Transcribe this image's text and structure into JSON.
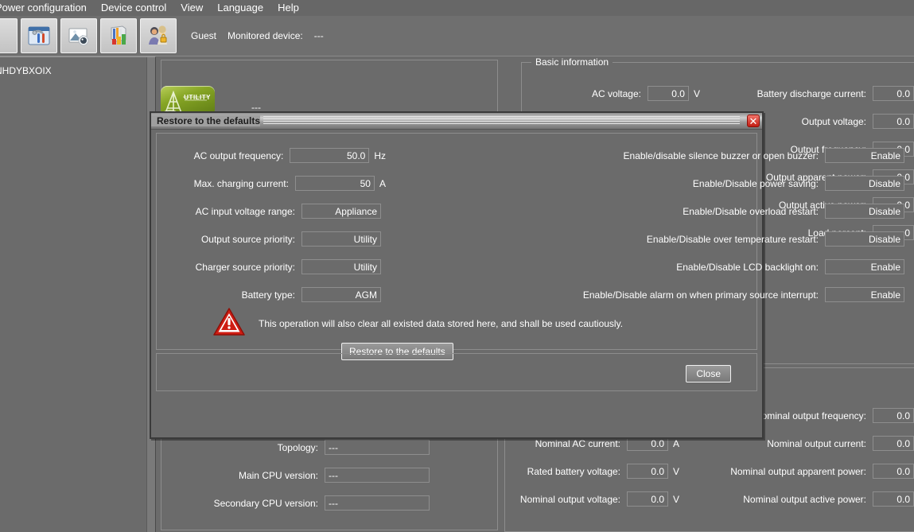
{
  "menu": {
    "items": [
      {
        "label": "Power configuration"
      },
      {
        "label": "Device control"
      },
      {
        "label": "View"
      },
      {
        "label": "Language"
      },
      {
        "label": "Help"
      }
    ]
  },
  "toolbar": {
    "buttons": [
      {
        "icon": "settings-tools-icon",
        "name": "toolbar-settings"
      },
      {
        "icon": "monitor-image-icon",
        "name": "toolbar-monitor"
      },
      {
        "icon": "chart-books-icon",
        "name": "toolbar-reports"
      },
      {
        "icon": "users-security-icon",
        "name": "toolbar-users"
      }
    ],
    "user_label": "Guest",
    "monitored_device_label": "Monitored device:",
    "monitored_device_value": "---"
  },
  "sidebar": {
    "tree_node": "NHDYBXOIX"
  },
  "center": {
    "utility_badge_label": "UTILITY",
    "value_dash": "---"
  },
  "basic_information": {
    "group_title": "Basic information",
    "left_rows": [
      {
        "label": "AC voltage:",
        "value": "0.0",
        "unit": "V"
      }
    ],
    "right_rows": [
      {
        "label": "Battery discharge current:",
        "value": "0.0"
      },
      {
        "label": "Output voltage:",
        "value": "0.0"
      },
      {
        "label": "Output frequency:",
        "value": "0.0"
      },
      {
        "label": "Output apparent power:",
        "value": "0.0"
      },
      {
        "label": "Output active power:",
        "value": "0.0"
      },
      {
        "label": "Load percent:",
        "value": "0"
      }
    ]
  },
  "rating_information": {
    "middle_rows": [
      {
        "label": "Topology:",
        "value": "---",
        "unit": ""
      },
      {
        "label": "Main CPU version:",
        "value": "---",
        "unit": ""
      },
      {
        "label": "Secondary CPU version:",
        "value": "---",
        "unit": ""
      }
    ],
    "mid_bottom_rows": [
      {
        "label": "Nominal AC current:",
        "value": "0.0",
        "unit": "A"
      },
      {
        "label": "Rated battery voltage:",
        "value": "0.0",
        "unit": "V"
      },
      {
        "label": "Nominal output voltage:",
        "value": "0.0",
        "unit": "V"
      }
    ],
    "right_bottom_rows": [
      {
        "label": "Nominal output frequency:",
        "value": "0.0"
      },
      {
        "label": "Nominal output current:",
        "value": "0.0"
      },
      {
        "label": "Nominal output apparent power:",
        "value": "0.0"
      },
      {
        "label": "Nominal output active power:",
        "value": "0.0"
      }
    ]
  },
  "dialog": {
    "title": "Restore to the defaults",
    "close_icon": "close-x-icon",
    "left_fields": [
      {
        "label": "AC output frequency:",
        "value": "50.0",
        "unit": "Hz"
      },
      {
        "label": "Max. charging current:",
        "value": "50",
        "unit": "A"
      },
      {
        "label": "AC input voltage range:",
        "value": "Appliance",
        "unit": ""
      },
      {
        "label": "Output source priority:",
        "value": "Utility",
        "unit": ""
      },
      {
        "label": "Charger source priority:",
        "value": "Utility",
        "unit": ""
      },
      {
        "label": "Battery type:",
        "value": "AGM",
        "unit": ""
      }
    ],
    "right_fields": [
      {
        "label": "Enable/disable silence buzzer or open buzzer:",
        "value": "Enable"
      },
      {
        "label": "Enable/Disable power saving:",
        "value": "Disable"
      },
      {
        "label": "Enable/Disable overload restart:",
        "value": "Disable"
      },
      {
        "label": "Enable/Disable over temperature restart:",
        "value": "Disable"
      },
      {
        "label": "Enable/Disable LCD backlight on:",
        "value": "Enable"
      },
      {
        "label": "Enable/Disable alarm on when primary source interrupt:",
        "value": "Enable"
      }
    ],
    "warning_icon": "warning-triangle-icon",
    "warning_text": "This operation will also clear all existed data stored here, and shall be used cautiously.",
    "restore_button": "Restore to the defaults",
    "close_button": "Close"
  },
  "colors": {
    "app_bg": "#6b6b6b",
    "toolbar_bg": "#6f6f6f",
    "dialog_bg": "#6b6b6b",
    "field_border": "#8e8e8e",
    "warning_red": "#c21d13",
    "utility_green": "#86a524",
    "text": "#ffffff"
  }
}
